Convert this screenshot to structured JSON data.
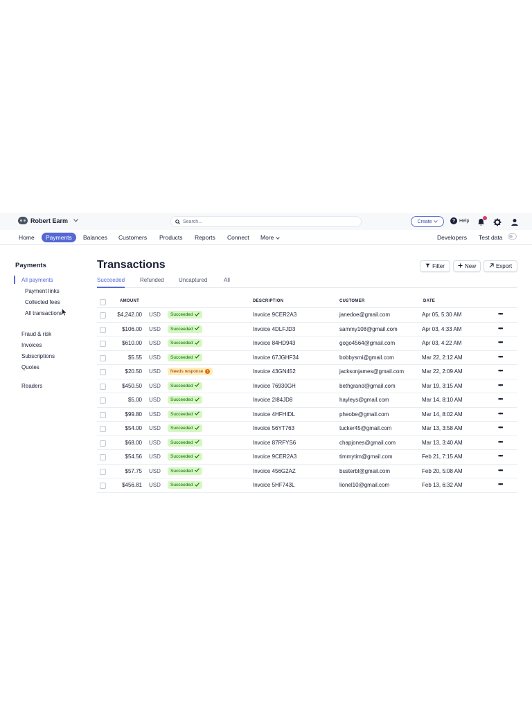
{
  "account": {
    "name": "Robert Earm"
  },
  "search": {
    "placeholder": "Search..."
  },
  "topbar": {
    "create_label": "Create",
    "help_label": "Help"
  },
  "nav": {
    "items": [
      "Home",
      "Payments",
      "Balances",
      "Customers",
      "Products",
      "Reports",
      "Connect",
      "More"
    ],
    "active": "Payments",
    "developers_label": "Developers",
    "test_data_label": "Test data"
  },
  "sidebar": {
    "title": "Payments",
    "items": [
      "All payments",
      "Payment links",
      "Collected fees",
      "All transactions",
      "Fraud & risk",
      "Invoices",
      "Subscriptions",
      "Quotes",
      "Readers"
    ],
    "active": "All payments"
  },
  "main": {
    "title": "Transactions",
    "filter_label": "Filter",
    "new_label": "New",
    "export_label": "Export",
    "tabs": [
      "Succeeded",
      "Refunded",
      "Uncaptured",
      "All"
    ],
    "active_tab": "Succeeded",
    "columns": {
      "amount": "AMOUNT",
      "description": "DESCRIPTION",
      "customer": "CUSTOMER",
      "date": "DATE"
    },
    "rows": [
      {
        "amount": "$4,242.00",
        "currency": "USD",
        "status": "Succeeded",
        "description": "Invoice 9CER2A3",
        "customer": "janedoe@gmail.com",
        "date": "Apr 05, 5:30 AM"
      },
      {
        "amount": "$106.00",
        "currency": "USD",
        "status": "Succeeded",
        "description": "Invoice 4DLFJD3",
        "customer": "sammy108@gmail.com",
        "date": "Apr 03, 4:33 AM"
      },
      {
        "amount": "$610.00",
        "currency": "USD",
        "status": "Succeeded",
        "description": "Invoice 84HD943",
        "customer": "gogo4564@gmail.com",
        "date": "Apr 03, 4:22 AM"
      },
      {
        "amount": "$5.55",
        "currency": "USD",
        "status": "Succeeded",
        "description": "Invoice 67JGHF34",
        "customer": "bobbysmi@gmail.com",
        "date": "Mar 22, 2:12 AM"
      },
      {
        "amount": "$20.50",
        "currency": "USD",
        "status": "Needs response",
        "description": "Invoice 43GN452",
        "customer": "jacksonjames@gmail.com",
        "date": "Mar 22, 2:09 AM"
      },
      {
        "amount": "$450.50",
        "currency": "USD",
        "status": "Succeeded",
        "description": "Invoice 76930GH",
        "customer": "bethgrand@gmail.com",
        "date": "Mar 19, 3:15 AM"
      },
      {
        "amount": "$5.00",
        "currency": "USD",
        "status": "Succeeded",
        "description": "Invoice 2I84JD8",
        "customer": "hayleys@gmail.com",
        "date": "Mar 14, 8:10 AM"
      },
      {
        "amount": "$99.80",
        "currency": "USD",
        "status": "Succeeded",
        "description": "Invoice 4HFHIDL",
        "customer": "pheobe@gmail.com",
        "date": "Mar 14, 8:02 AM"
      },
      {
        "amount": "$54.00",
        "currency": "USD",
        "status": "Succeeded",
        "description": "Invoice 56YT763",
        "customer": "tucker45@gmail.com",
        "date": "Mar 13, 3:58 AM"
      },
      {
        "amount": "$68.00",
        "currency": "USD",
        "status": "Succeeded",
        "description": "Invoice 87RFYS6",
        "customer": "chapjones@gmail.com",
        "date": "Mar 13, 3:40 AM"
      },
      {
        "amount": "$54.56",
        "currency": "USD",
        "status": "Succeeded",
        "description": "Invoice 9CER2A3",
        "customer": "timmytim@gmail.com",
        "date": "Feb 21, 7:15 AM"
      },
      {
        "amount": "$57.75",
        "currency": "USD",
        "status": "Succeeded",
        "description": "Invoice 456G2AZ",
        "customer": "busterbl@gmail.com",
        "date": "Feb 20, 5:08 AM"
      },
      {
        "amount": "$456.81",
        "currency": "USD",
        "status": "Succeeded",
        "description": "Invoice 5HF743L",
        "customer": "lionel10@gmail.com",
        "date": "Feb 13, 6:32 AM"
      }
    ],
    "more_glyph": "•••"
  },
  "colors": {
    "accent": "#5469d4",
    "success_bg": "#d7f7c2",
    "success_fg": "#05690d",
    "warning_bg": "#fcedb9",
    "warning_fg": "#a82c00"
  }
}
